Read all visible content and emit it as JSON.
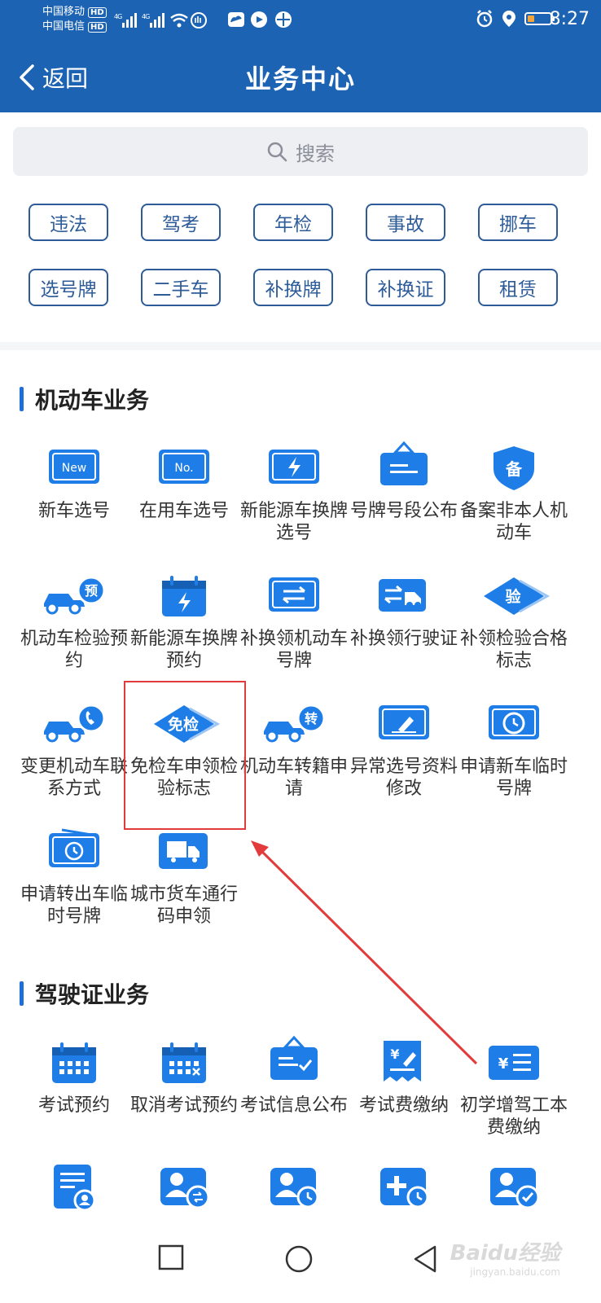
{
  "status_bar": {
    "carrier1": "中国移动",
    "carrier2": "中国电信",
    "hd": "HD",
    "net": "4G",
    "time": "8:27",
    "battery_level": 0.3
  },
  "header": {
    "back_label": "返回",
    "title": "业务中心"
  },
  "search": {
    "placeholder": "搜索"
  },
  "quick_tags": [
    "违法",
    "驾考",
    "年检",
    "事故",
    "挪车",
    "选号牌",
    "二手车",
    "补换牌",
    "补换证",
    "租赁"
  ],
  "sections": [
    {
      "title": "机动车业务",
      "items": [
        {
          "icon": "new-plate-icon",
          "label": "新车选号"
        },
        {
          "icon": "used-plate-icon",
          "label": "在用车选号"
        },
        {
          "icon": "ev-plate-icon",
          "label": "新能源车换牌选号"
        },
        {
          "icon": "plate-segment-sign-icon",
          "label": "号牌号段公布"
        },
        {
          "icon": "record-shield-icon",
          "label": "备案非本人机动车"
        },
        {
          "icon": "car-inspection-booking-icon",
          "label": "机动车检验预约"
        },
        {
          "icon": "ev-calendar-icon",
          "label": "新能源车换牌预约"
        },
        {
          "icon": "plate-exchange-icon",
          "label": "补换领机动车号牌"
        },
        {
          "icon": "license-exchange-car-icon",
          "label": "补换领行驶证"
        },
        {
          "icon": "inspection-diamond-icon",
          "label": "补领检验合格标志"
        },
        {
          "icon": "car-phone-icon",
          "label": "变更机动车联系方式"
        },
        {
          "icon": "exempt-inspection-diamond-icon",
          "label": "免检车申领检验标志"
        },
        {
          "icon": "car-transfer-icon",
          "label": "机动车转籍申请"
        },
        {
          "icon": "edit-plate-icon",
          "label": "异常选号资料修改"
        },
        {
          "icon": "temp-plate-clock-icon",
          "label": "申请新车临时号牌"
        },
        {
          "icon": "transfer-temp-plate-icon",
          "label": "申请转出车临时号牌"
        },
        {
          "icon": "truck-pass-icon",
          "label": "城市货车通行码申领"
        }
      ]
    },
    {
      "title": "驾驶证业务",
      "items": [
        {
          "icon": "exam-calendar-icon",
          "label": "考试预约"
        },
        {
          "icon": "cancel-exam-calendar-icon",
          "label": "取消考试预约"
        },
        {
          "icon": "exam-info-board-icon",
          "label": "考试信息公布"
        },
        {
          "icon": "exam-fee-receipt-icon",
          "label": "考试费缴纳"
        },
        {
          "icon": "fee-list-icon",
          "label": "初学增驾工本费缴纳"
        },
        {
          "icon": "document-user-icon",
          "label": ""
        },
        {
          "icon": "user-exchange-icon",
          "label": ""
        },
        {
          "icon": "user-clock-icon",
          "label": ""
        },
        {
          "icon": "plus-clock-icon",
          "label": ""
        },
        {
          "icon": "user-check-icon",
          "label": ""
        }
      ]
    }
  ],
  "highlight_label": "免检车申领检验标志",
  "watermark": {
    "text": "Baidu经验",
    "sub": "jingyan.baidu.com"
  },
  "colors": {
    "primary": "#1c64b3",
    "icon": "#1e7de6",
    "tag": "#2d5c99",
    "annotation": "#e23b3b"
  }
}
